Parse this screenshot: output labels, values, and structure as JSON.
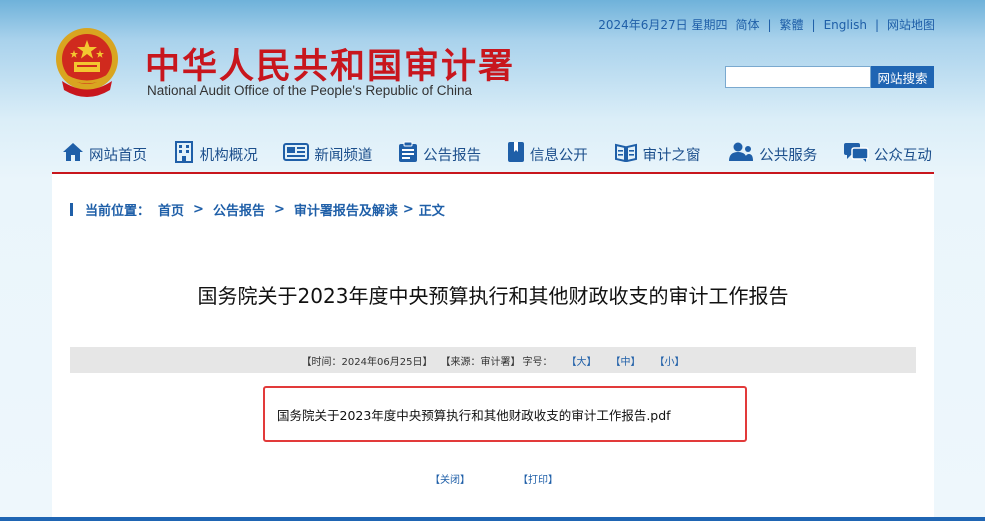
{
  "header": {
    "date": "2024年6月27日 星期四",
    "links": [
      "简体",
      "繁體",
      "English",
      "网站地图"
    ],
    "site_title": "中华人民共和国审计署",
    "site_subtitle": "National Audit Office of the People's Republic of China",
    "search_placeholder": "",
    "search_button": "网站搜索"
  },
  "nav": {
    "items": [
      {
        "label": "网站首页",
        "icon": "home-icon"
      },
      {
        "label": "机构概况",
        "icon": "building-icon"
      },
      {
        "label": "新闻频道",
        "icon": "newspaper-icon"
      },
      {
        "label": "公告报告",
        "icon": "clipboard-icon"
      },
      {
        "label": "信息公开",
        "icon": "book-icon"
      },
      {
        "label": "审计之窗",
        "icon": "open-book-icon"
      },
      {
        "label": "公共服务",
        "icon": "people-icon"
      },
      {
        "label": "公众互动",
        "icon": "chat-icon"
      }
    ]
  },
  "breadcrumb": {
    "prefix": "当前位置：",
    "items": [
      "首页",
      "公告报告",
      "审计署报告及解读",
      "正文"
    ],
    "separator": ">"
  },
  "article": {
    "title": "国务院关于2023年度中央预算执行和其他财政收支的审计工作报告",
    "meta_time": "【时间：2024年06月25日】",
    "meta_source": "【来源：审计署】",
    "meta_font_label": "字号：",
    "size_large": "【大】",
    "size_medium": "【中】",
    "size_small": "【小】",
    "attachment": "国务院关于2023年度中央预算执行和其他财政收支的审计工作报告.pdf"
  },
  "actions": {
    "close": "【关闭】",
    "print": "【打印】"
  },
  "colors": {
    "title_red": "#c8161d",
    "link_blue": "#1f5fa8",
    "highlight_border": "#e23a3a"
  }
}
